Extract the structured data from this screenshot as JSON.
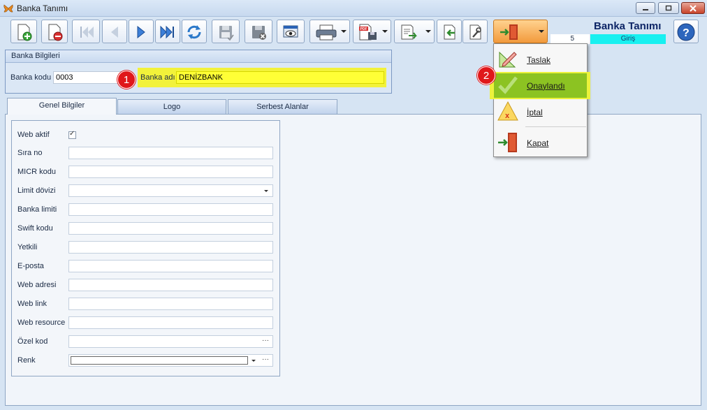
{
  "window": {
    "title": "Banka Tanımı",
    "icon": "butterfly-icon"
  },
  "toolbar": {
    "buttons": [
      "new-document-icon",
      "delete-document-icon",
      "first-record-icon",
      "previous-record-icon",
      "next-record-icon",
      "last-record-icon",
      "refresh-icon",
      "save-icon",
      "cancel-save-icon",
      "preview-icon",
      "print-icon",
      "pdf-export-icon",
      "document-transfer-icon",
      "back-icon",
      "tools-icon",
      "exit-door-icon"
    ]
  },
  "header": {
    "form_title": "Banka Tanımı",
    "record_no": "5",
    "status": "Giriş",
    "status_color": "#18f0f0"
  },
  "bank_info": {
    "group_title": "Banka Bilgileri",
    "code_label": "Banka kodu",
    "code_value": "0003",
    "name_label": "Banka adı",
    "name_value": "DENİZBANK",
    "highlight_color": "#f2f23a"
  },
  "markers": {
    "m1": "1",
    "m2": "2"
  },
  "tabs": [
    {
      "label": "Genel Bilgiler",
      "active": true
    },
    {
      "label": "Logo",
      "active": false
    },
    {
      "label": "Serbest Alanlar",
      "active": false
    }
  ],
  "general": {
    "web_active_label": "Web aktif",
    "web_active_checked": true,
    "check_mark": "✓",
    "fields": [
      {
        "label": "Sıra no",
        "value": ""
      },
      {
        "label": "MICR kodu",
        "value": ""
      },
      {
        "label": "Limit dövizi",
        "value": ""
      },
      {
        "label": "Banka limiti",
        "value": ""
      },
      {
        "label": "Swift kodu",
        "value": ""
      },
      {
        "label": "Yetkili",
        "value": ""
      },
      {
        "label": "E-posta",
        "value": ""
      },
      {
        "label": "Web adresi",
        "value": ""
      },
      {
        "label": "Web link",
        "value": ""
      },
      {
        "label": "Web resource",
        "value": ""
      },
      {
        "label": "Özel kod",
        "value": ""
      },
      {
        "label": "Renk",
        "value": ""
      }
    ],
    "ellipsis": "···"
  },
  "status_menu": {
    "items": [
      {
        "label": "Taslak",
        "icon": "draft-pencil-icon"
      },
      {
        "label": "Onaylandı",
        "icon": "approved-check-icon",
        "selected": true
      },
      {
        "label": "İptal",
        "icon": "cancel-warning-icon"
      },
      {
        "label": "Kapat",
        "icon": "close-door-icon"
      }
    ],
    "selected_color": "#8cc322"
  }
}
